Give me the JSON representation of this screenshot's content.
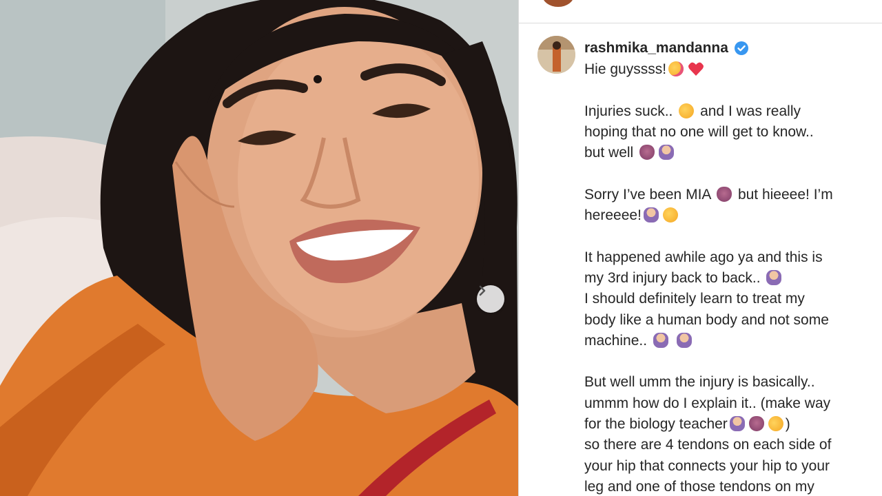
{
  "post": {
    "username": "rashmika_mandanna",
    "verified": true,
    "caption_lines": [
      "Hie guyssss!",
      "",
      "Injuries suck..",
      "and I was really",
      "hoping that no one will get to know..",
      "but well",
      "",
      "Sorry I’ve been MIA",
      "but hieeee! I’m",
      "hereeee!",
      "",
      "It happened awhile ago ya and this is",
      "my 3rd injury back to back..",
      "I should definitely learn to treat my",
      "body like a human body and not some",
      "machine..",
      "",
      "But well umm the injury is basically..",
      "ummm how do I explain it.. (make way",
      "for the biology teacher",
      ")",
      "so there are 4 tendons on each side of",
      "your hip that connects your hip to your",
      "leg and one of those tendons on my"
    ]
  },
  "media": {
    "next_icon": "chevron-right-icon"
  },
  "colors": {
    "verified": "#3897f0",
    "text": "#262626",
    "border": "#dbdbdb"
  }
}
